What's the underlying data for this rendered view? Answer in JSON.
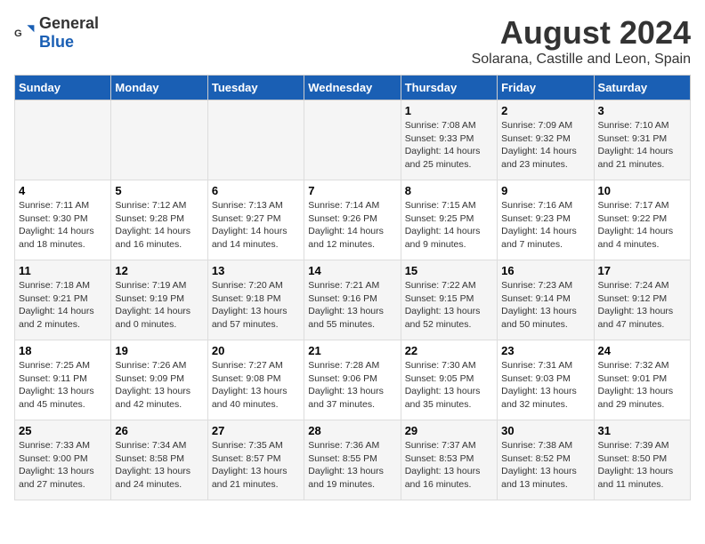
{
  "header": {
    "logo_general": "General",
    "logo_blue": "Blue",
    "title": "August 2024",
    "subtitle": "Solarana, Castille and Leon, Spain"
  },
  "days_of_week": [
    "Sunday",
    "Monday",
    "Tuesday",
    "Wednesday",
    "Thursday",
    "Friday",
    "Saturday"
  ],
  "weeks": [
    [
      {
        "day": "",
        "info": ""
      },
      {
        "day": "",
        "info": ""
      },
      {
        "day": "",
        "info": ""
      },
      {
        "day": "",
        "info": ""
      },
      {
        "day": "1",
        "info": "Sunrise: 7:08 AM\nSunset: 9:33 PM\nDaylight: 14 hours\nand 25 minutes."
      },
      {
        "day": "2",
        "info": "Sunrise: 7:09 AM\nSunset: 9:32 PM\nDaylight: 14 hours\nand 23 minutes."
      },
      {
        "day": "3",
        "info": "Sunrise: 7:10 AM\nSunset: 9:31 PM\nDaylight: 14 hours\nand 21 minutes."
      }
    ],
    [
      {
        "day": "4",
        "info": "Sunrise: 7:11 AM\nSunset: 9:30 PM\nDaylight: 14 hours\nand 18 minutes."
      },
      {
        "day": "5",
        "info": "Sunrise: 7:12 AM\nSunset: 9:28 PM\nDaylight: 14 hours\nand 16 minutes."
      },
      {
        "day": "6",
        "info": "Sunrise: 7:13 AM\nSunset: 9:27 PM\nDaylight: 14 hours\nand 14 minutes."
      },
      {
        "day": "7",
        "info": "Sunrise: 7:14 AM\nSunset: 9:26 PM\nDaylight: 14 hours\nand 12 minutes."
      },
      {
        "day": "8",
        "info": "Sunrise: 7:15 AM\nSunset: 9:25 PM\nDaylight: 14 hours\nand 9 minutes."
      },
      {
        "day": "9",
        "info": "Sunrise: 7:16 AM\nSunset: 9:23 PM\nDaylight: 14 hours\nand 7 minutes."
      },
      {
        "day": "10",
        "info": "Sunrise: 7:17 AM\nSunset: 9:22 PM\nDaylight: 14 hours\nand 4 minutes."
      }
    ],
    [
      {
        "day": "11",
        "info": "Sunrise: 7:18 AM\nSunset: 9:21 PM\nDaylight: 14 hours\nand 2 minutes."
      },
      {
        "day": "12",
        "info": "Sunrise: 7:19 AM\nSunset: 9:19 PM\nDaylight: 14 hours\nand 0 minutes."
      },
      {
        "day": "13",
        "info": "Sunrise: 7:20 AM\nSunset: 9:18 PM\nDaylight: 13 hours\nand 57 minutes."
      },
      {
        "day": "14",
        "info": "Sunrise: 7:21 AM\nSunset: 9:16 PM\nDaylight: 13 hours\nand 55 minutes."
      },
      {
        "day": "15",
        "info": "Sunrise: 7:22 AM\nSunset: 9:15 PM\nDaylight: 13 hours\nand 52 minutes."
      },
      {
        "day": "16",
        "info": "Sunrise: 7:23 AM\nSunset: 9:14 PM\nDaylight: 13 hours\nand 50 minutes."
      },
      {
        "day": "17",
        "info": "Sunrise: 7:24 AM\nSunset: 9:12 PM\nDaylight: 13 hours\nand 47 minutes."
      }
    ],
    [
      {
        "day": "18",
        "info": "Sunrise: 7:25 AM\nSunset: 9:11 PM\nDaylight: 13 hours\nand 45 minutes."
      },
      {
        "day": "19",
        "info": "Sunrise: 7:26 AM\nSunset: 9:09 PM\nDaylight: 13 hours\nand 42 minutes."
      },
      {
        "day": "20",
        "info": "Sunrise: 7:27 AM\nSunset: 9:08 PM\nDaylight: 13 hours\nand 40 minutes."
      },
      {
        "day": "21",
        "info": "Sunrise: 7:28 AM\nSunset: 9:06 PM\nDaylight: 13 hours\nand 37 minutes."
      },
      {
        "day": "22",
        "info": "Sunrise: 7:30 AM\nSunset: 9:05 PM\nDaylight: 13 hours\nand 35 minutes."
      },
      {
        "day": "23",
        "info": "Sunrise: 7:31 AM\nSunset: 9:03 PM\nDaylight: 13 hours\nand 32 minutes."
      },
      {
        "day": "24",
        "info": "Sunrise: 7:32 AM\nSunset: 9:01 PM\nDaylight: 13 hours\nand 29 minutes."
      }
    ],
    [
      {
        "day": "25",
        "info": "Sunrise: 7:33 AM\nSunset: 9:00 PM\nDaylight: 13 hours\nand 27 minutes."
      },
      {
        "day": "26",
        "info": "Sunrise: 7:34 AM\nSunset: 8:58 PM\nDaylight: 13 hours\nand 24 minutes."
      },
      {
        "day": "27",
        "info": "Sunrise: 7:35 AM\nSunset: 8:57 PM\nDaylight: 13 hours\nand 21 minutes."
      },
      {
        "day": "28",
        "info": "Sunrise: 7:36 AM\nSunset: 8:55 PM\nDaylight: 13 hours\nand 19 minutes."
      },
      {
        "day": "29",
        "info": "Sunrise: 7:37 AM\nSunset: 8:53 PM\nDaylight: 13 hours\nand 16 minutes."
      },
      {
        "day": "30",
        "info": "Sunrise: 7:38 AM\nSunset: 8:52 PM\nDaylight: 13 hours\nand 13 minutes."
      },
      {
        "day": "31",
        "info": "Sunrise: 7:39 AM\nSunset: 8:50 PM\nDaylight: 13 hours\nand 11 minutes."
      }
    ]
  ]
}
